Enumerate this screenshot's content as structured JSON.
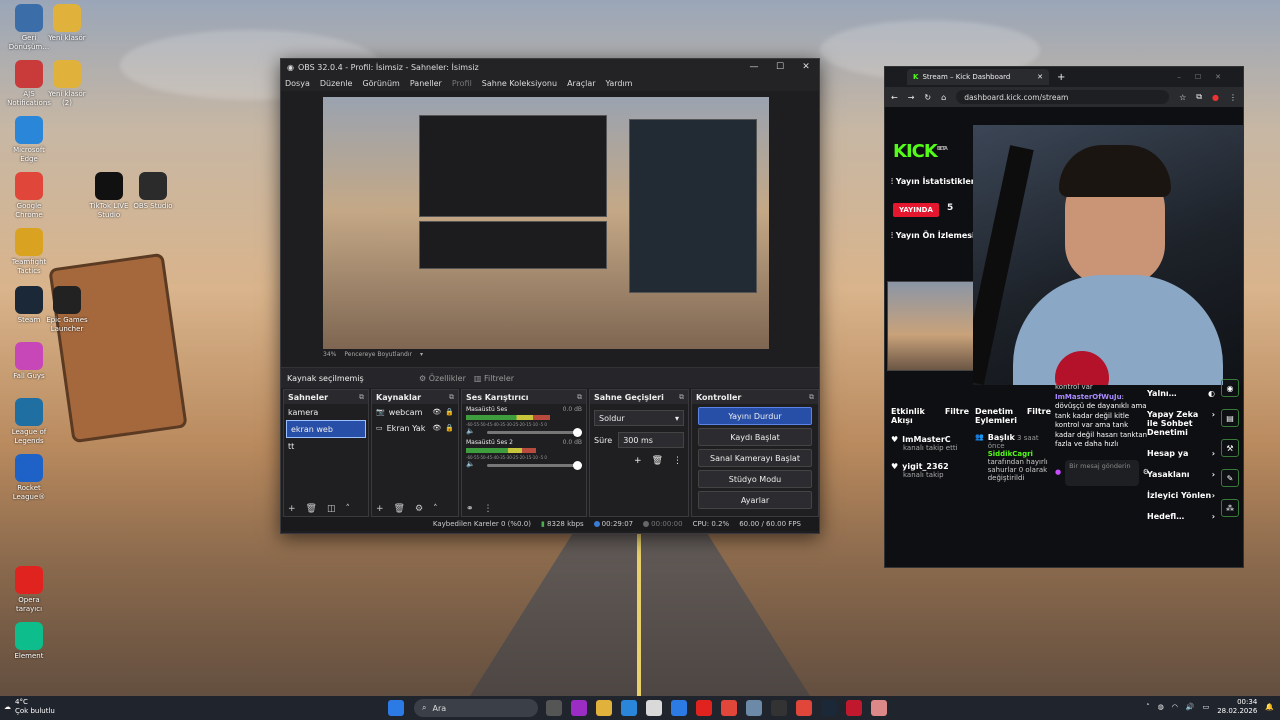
{
  "desktop": {
    "icons": [
      {
        "label": "Geri Dönüşüm…",
        "color": "#3b6ea8"
      },
      {
        "label": "Yeni klasör",
        "color": "#e0b23c"
      },
      {
        "label": "AJS Notifications",
        "color": "#c93b3b"
      },
      {
        "label": "Yeni klasör (2)",
        "color": "#e0b23c"
      },
      {
        "label": "Microsoft Edge",
        "color": "#2a86d8"
      },
      {
        "label": "Google Chrome",
        "color": "#e0473a"
      },
      {
        "label": "TikTok LIVE Studio",
        "color": "#111111"
      },
      {
        "label": "OBS Studio",
        "color": "#2b2b2b"
      },
      {
        "label": "Teamfight Tactics",
        "color": "#d9a321"
      },
      {
        "label": "Steam",
        "color": "#1b2838"
      },
      {
        "label": "Epic Games Launcher",
        "color": "#222222"
      },
      {
        "label": "Fall Guys",
        "color": "#c847b8"
      },
      {
        "label": "League of Legends",
        "color": "#1f6fa3"
      },
      {
        "label": "Rocket League®",
        "color": "#1e62c7"
      },
      {
        "label": "Opera tarayıcı",
        "color": "#e0231f"
      },
      {
        "label": "Element",
        "color": "#0dbd8b"
      }
    ]
  },
  "obs": {
    "title": "OBS 32.0.4 - Profil: İsimsiz - Sahneler: İsimsiz",
    "menu": [
      "Dosya",
      "Düzenle",
      "Görünüm",
      "Paneller",
      "Profil",
      "Sahne Koleksiyonu",
      "Araçlar",
      "Yardım"
    ],
    "preview_bar": {
      "zoom": "34%",
      "mode": "Pencereye Boyutlandır"
    },
    "source_bar": {
      "label": "Kaynak seçilmemiş",
      "properties": "Özellikler",
      "filters": "Filtreler"
    },
    "scenes": {
      "title": "Sahneler",
      "items": [
        "kamera",
        "ekran web",
        "tt"
      ],
      "selected_index": 1
    },
    "sources": {
      "title": "Kaynaklar",
      "items": [
        "webcam",
        "Ekran Yak"
      ]
    },
    "mixer": {
      "title": "Ses Karıştırıcı",
      "channels": [
        {
          "name": "Masaüstü Ses",
          "db": "0.0 dB",
          "level": 0.72
        },
        {
          "name": "Masaüstü Ses 2",
          "db": "0.0 dB",
          "level": 0.6
        }
      ],
      "scale": "-60-55-50-45-40-35-30-25-20-15-10 -5  0"
    },
    "transitions": {
      "title": "Sahne Geçişleri",
      "type": "Soldur",
      "duration_label": "Süre",
      "duration": "300 ms"
    },
    "controls": {
      "title": "Kontroller",
      "buttons": [
        "Yayını Durdur",
        "Kaydı Başlat",
        "Sanal Kamerayı Başlat",
        "Stüdyo Modu",
        "Ayarlar"
      ]
    },
    "status": {
      "dropped": "Kaybedilen Kareler 0 (%0.0)",
      "bitrate": "8328 kbps",
      "stream_time": "00:29:07",
      "rec_time": "00:00:00",
      "cpu": "CPU: 0.2%",
      "fps": "60.00 / 60.00 FPS"
    }
  },
  "browser": {
    "tab_title": "Stream – Kick Dashboard",
    "url": "dashboard.kick.com/stream",
    "kick": {
      "logo": "KICK",
      "logo_sup": "BETA",
      "stats_title": "Yayın İstatistikleri",
      "live": "YAYINDA",
      "viewers": "5",
      "preview_title": "Yayın Ön İzlemesi",
      "activity_title": "Etkinlik Akışı",
      "filter": "Filtre",
      "activity": [
        {
          "user": "ImMasterC",
          "detail": "kanalı takip etti"
        },
        {
          "user": "yigit_2362",
          "detail": "kanalı takip"
        }
      ],
      "mod_title": "Denetim Eylemleri",
      "mod_filter": "Filtre",
      "mod_event_title": "Başlık",
      "mod_event_time": "3 saat önce",
      "mod_event_user": "SiddikCagri",
      "mod_event_text": "tarafından hayırlı sahurlar 0 olarak değiştirildi",
      "chat_prev": "kontrol var",
      "chat_user": "ImMasterOfWuJu",
      "chat_text": "dövüşçü de dayanıklı ama tank kadar değil kitle kontrol var ama tank kadar değil hasarı tanktan fazla ve daha hızlı",
      "chat_input_placeholder": "Bir mesaj gönderin",
      "side": [
        {
          "label": "Yalnı…"
        },
        {
          "label": "Yapay Zeka ile Sohbet Denetimi"
        },
        {
          "label": "Hesap ya"
        },
        {
          "label": "Yasaklanı"
        },
        {
          "label": "İzleyici Yönlen"
        },
        {
          "label": "Hedefl…"
        }
      ]
    }
  },
  "taskbar": {
    "weather_temp": "4°C",
    "weather_desc": "Çok bulutlu",
    "search": "Ara",
    "time": "00:34",
    "date": "28.02.2026"
  }
}
